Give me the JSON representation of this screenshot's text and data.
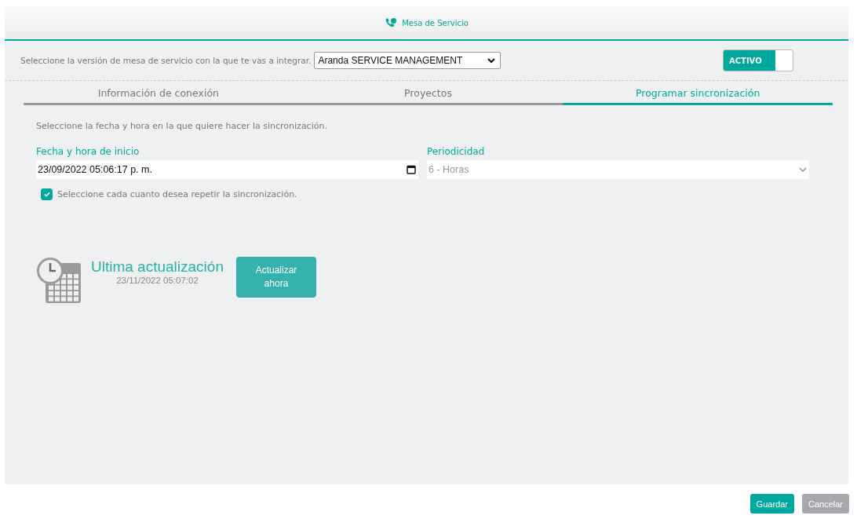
{
  "header": {
    "title": "Mesa de Servicio"
  },
  "version": {
    "label": "Seleccione la versión de mesa de servicio con la que te vas a integrar.",
    "value": "Aranda SERVICE MANAGEMENT"
  },
  "status_toggle": {
    "label": "ACTIVO",
    "on": true
  },
  "tabs": [
    {
      "label": "Información de conexión",
      "selected": false
    },
    {
      "label": "Proyectos",
      "selected": false
    },
    {
      "label": "Programar sincronización",
      "selected": true
    }
  ],
  "intro": "Seleccione la fecha y hora en la que quiere hacer la sincronización.",
  "start": {
    "label": "Fecha y hora de inicio",
    "value": "23/09/2022 05:06:17 p. m."
  },
  "periodicity": {
    "label": "Periodicidad",
    "value": "6 - Horas",
    "disabled": true
  },
  "repeat": {
    "label": "Seleccione cada cuanto desea repetir la sincronización.",
    "checked": true
  },
  "last_update": {
    "title": "Ultima actualización",
    "time": "23/11/2022 05:07:02",
    "button": "Actualizar\nahora"
  },
  "buttons": [
    {
      "label": "Guardar",
      "disabled": false
    },
    {
      "label": "Cancelar",
      "disabled": true
    }
  ]
}
